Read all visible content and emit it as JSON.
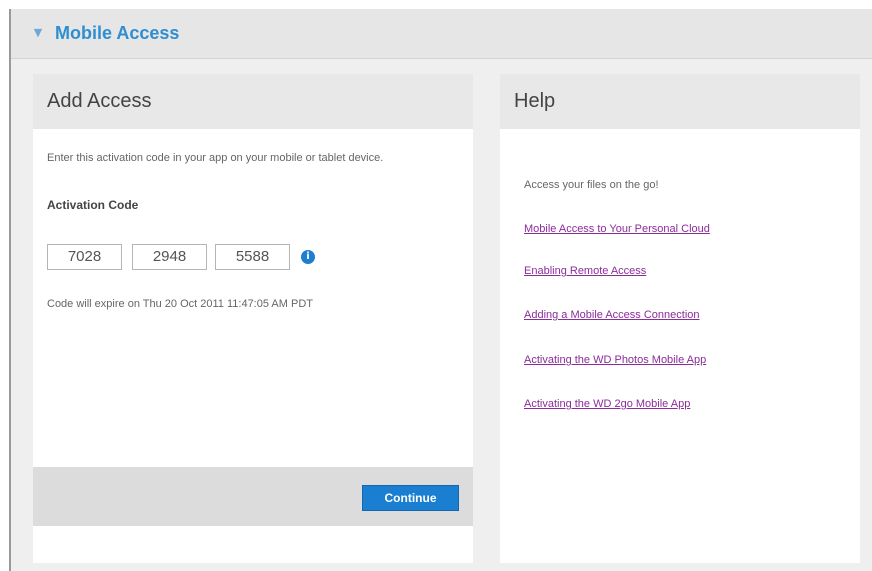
{
  "section": {
    "title": "Mobile Access",
    "collapse_icon": "chevron-down-icon"
  },
  "add_access": {
    "title": "Add Access",
    "instructions": "Enter this activation code in your app on your mobile or tablet device.",
    "activation_label": "Activation Code",
    "code": [
      "7028",
      "2948",
      "5588"
    ],
    "info_icon": "info-icon",
    "expires_text": "Code will expire on Thu 20 Oct 2011 11:47:05 AM PDT",
    "continue_label": "Continue"
  },
  "help": {
    "title": "Help",
    "intro": "Access your files on the go!",
    "links": [
      "Mobile Access to Your Personal Cloud",
      "Enabling Remote Access",
      "Adding a Mobile Access Connection",
      "Activating the WD Photos Mobile App",
      "Activating the WD 2go Mobile App"
    ]
  },
  "colors": {
    "accent": "#2f8ed0",
    "button": "#1a7fd0",
    "link": "#8b2c9a",
    "info_icon": "#1f7fcf"
  }
}
